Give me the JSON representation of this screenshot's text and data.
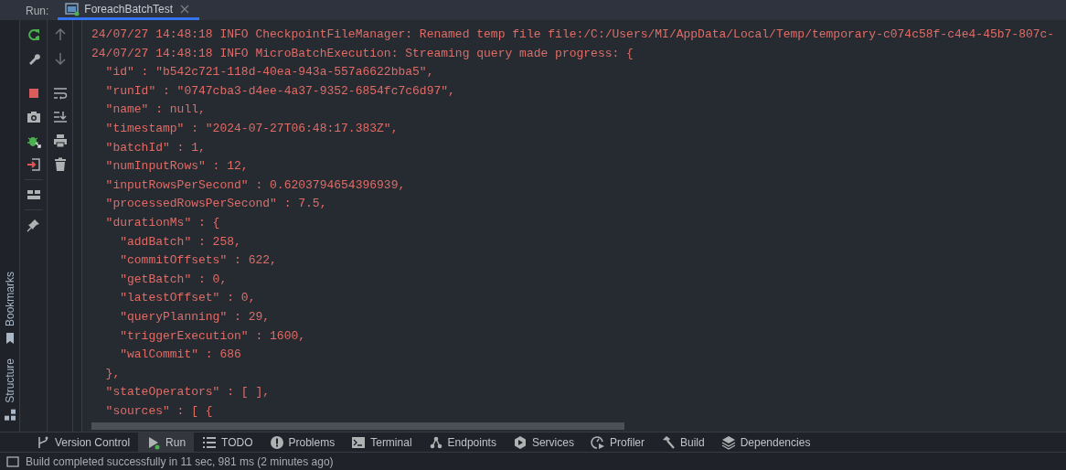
{
  "run_bar": {
    "label": "Run:",
    "tabs": [
      {
        "label": "ForeachBatchTest",
        "selected": true
      }
    ]
  },
  "side_tools": [
    {
      "label": "Bookmarks"
    },
    {
      "label": "Structure"
    }
  ],
  "console_lines": [
    "24/07/27 14:48:18 INFO CheckpointFileManager: Renamed temp file file:/C:/Users/MI/AppData/Local/Temp/temporary-c074c58f-c4e4-45b7-807c-",
    "24/07/27 14:48:18 INFO MicroBatchExecution: Streaming query made progress: {",
    "  \"id\" : \"b542c721-118d-40ea-943a-557a6622bba5\",",
    "  \"runId\" : \"0747cba3-d4ee-4a37-9352-6854fc7c6d97\",",
    "  \"name\" : null,",
    "  \"timestamp\" : \"2024-07-27T06:48:17.383Z\",",
    "  \"batchId\" : 1,",
    "  \"numInputRows\" : 12,",
    "  \"inputRowsPerSecond\" : 0.6203794654396939,",
    "  \"processedRowsPerSecond\" : 7.5,",
    "  \"durationMs\" : {",
    "    \"addBatch\" : 258,",
    "    \"commitOffsets\" : 622,",
    "    \"getBatch\" : 0,",
    "    \"latestOffset\" : 0,",
    "    \"queryPlanning\" : 29,",
    "    \"triggerExecution\" : 1600,",
    "    \"walCommit\" : 686",
    "  },",
    "  \"stateOperators\" : [ ],",
    "  \"sources\" : [ {"
  ],
  "tool_windows": [
    {
      "label": "Version Control",
      "selected": false
    },
    {
      "label": "Run",
      "selected": true
    },
    {
      "label": "TODO",
      "selected": false
    },
    {
      "label": "Problems",
      "selected": false
    },
    {
      "label": "Terminal",
      "selected": false
    },
    {
      "label": "Endpoints",
      "selected": false
    },
    {
      "label": "Services",
      "selected": false
    },
    {
      "label": "Profiler",
      "selected": false
    },
    {
      "label": "Build",
      "selected": false
    },
    {
      "label": "Dependencies",
      "selected": false
    }
  ],
  "status_bar": {
    "text": "Build completed successfully in 11 sec, 981 ms (2 minutes ago)"
  }
}
